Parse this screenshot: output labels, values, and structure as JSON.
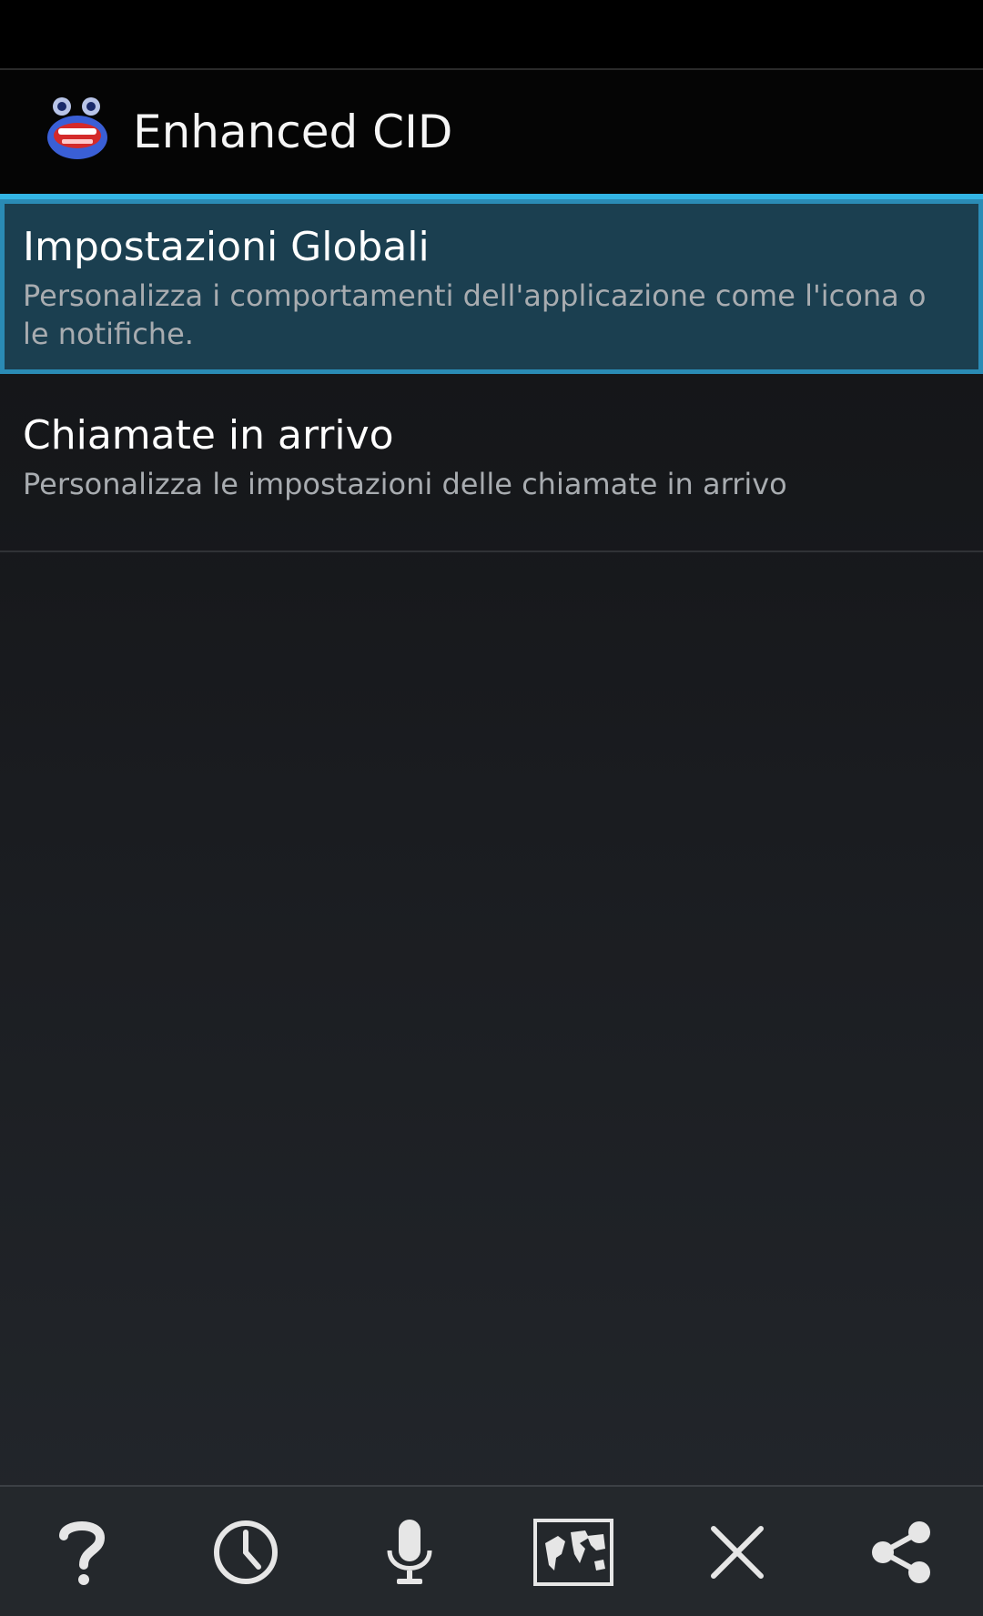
{
  "app": {
    "title": "Enhanced CID",
    "icon": "app-face-icon"
  },
  "preferences": [
    {
      "title": "Impostazioni Globali",
      "summary": "Personalizza i comportamenti dell'applicazione come l'icona o le notifiche.",
      "selected": true
    },
    {
      "title": "Chiamate in arrivo",
      "summary": "Personalizza le impostazioni delle chiamate in arrivo",
      "selected": false
    }
  ],
  "bottom_bar": {
    "buttons": [
      "help-icon",
      "clock-icon",
      "microphone-icon",
      "world-map-icon",
      "close-icon",
      "share-icon"
    ]
  },
  "colors": {
    "accent": "#33b5e5",
    "selected_background": "#1b3f50",
    "selected_border": "#2a8bb5"
  }
}
